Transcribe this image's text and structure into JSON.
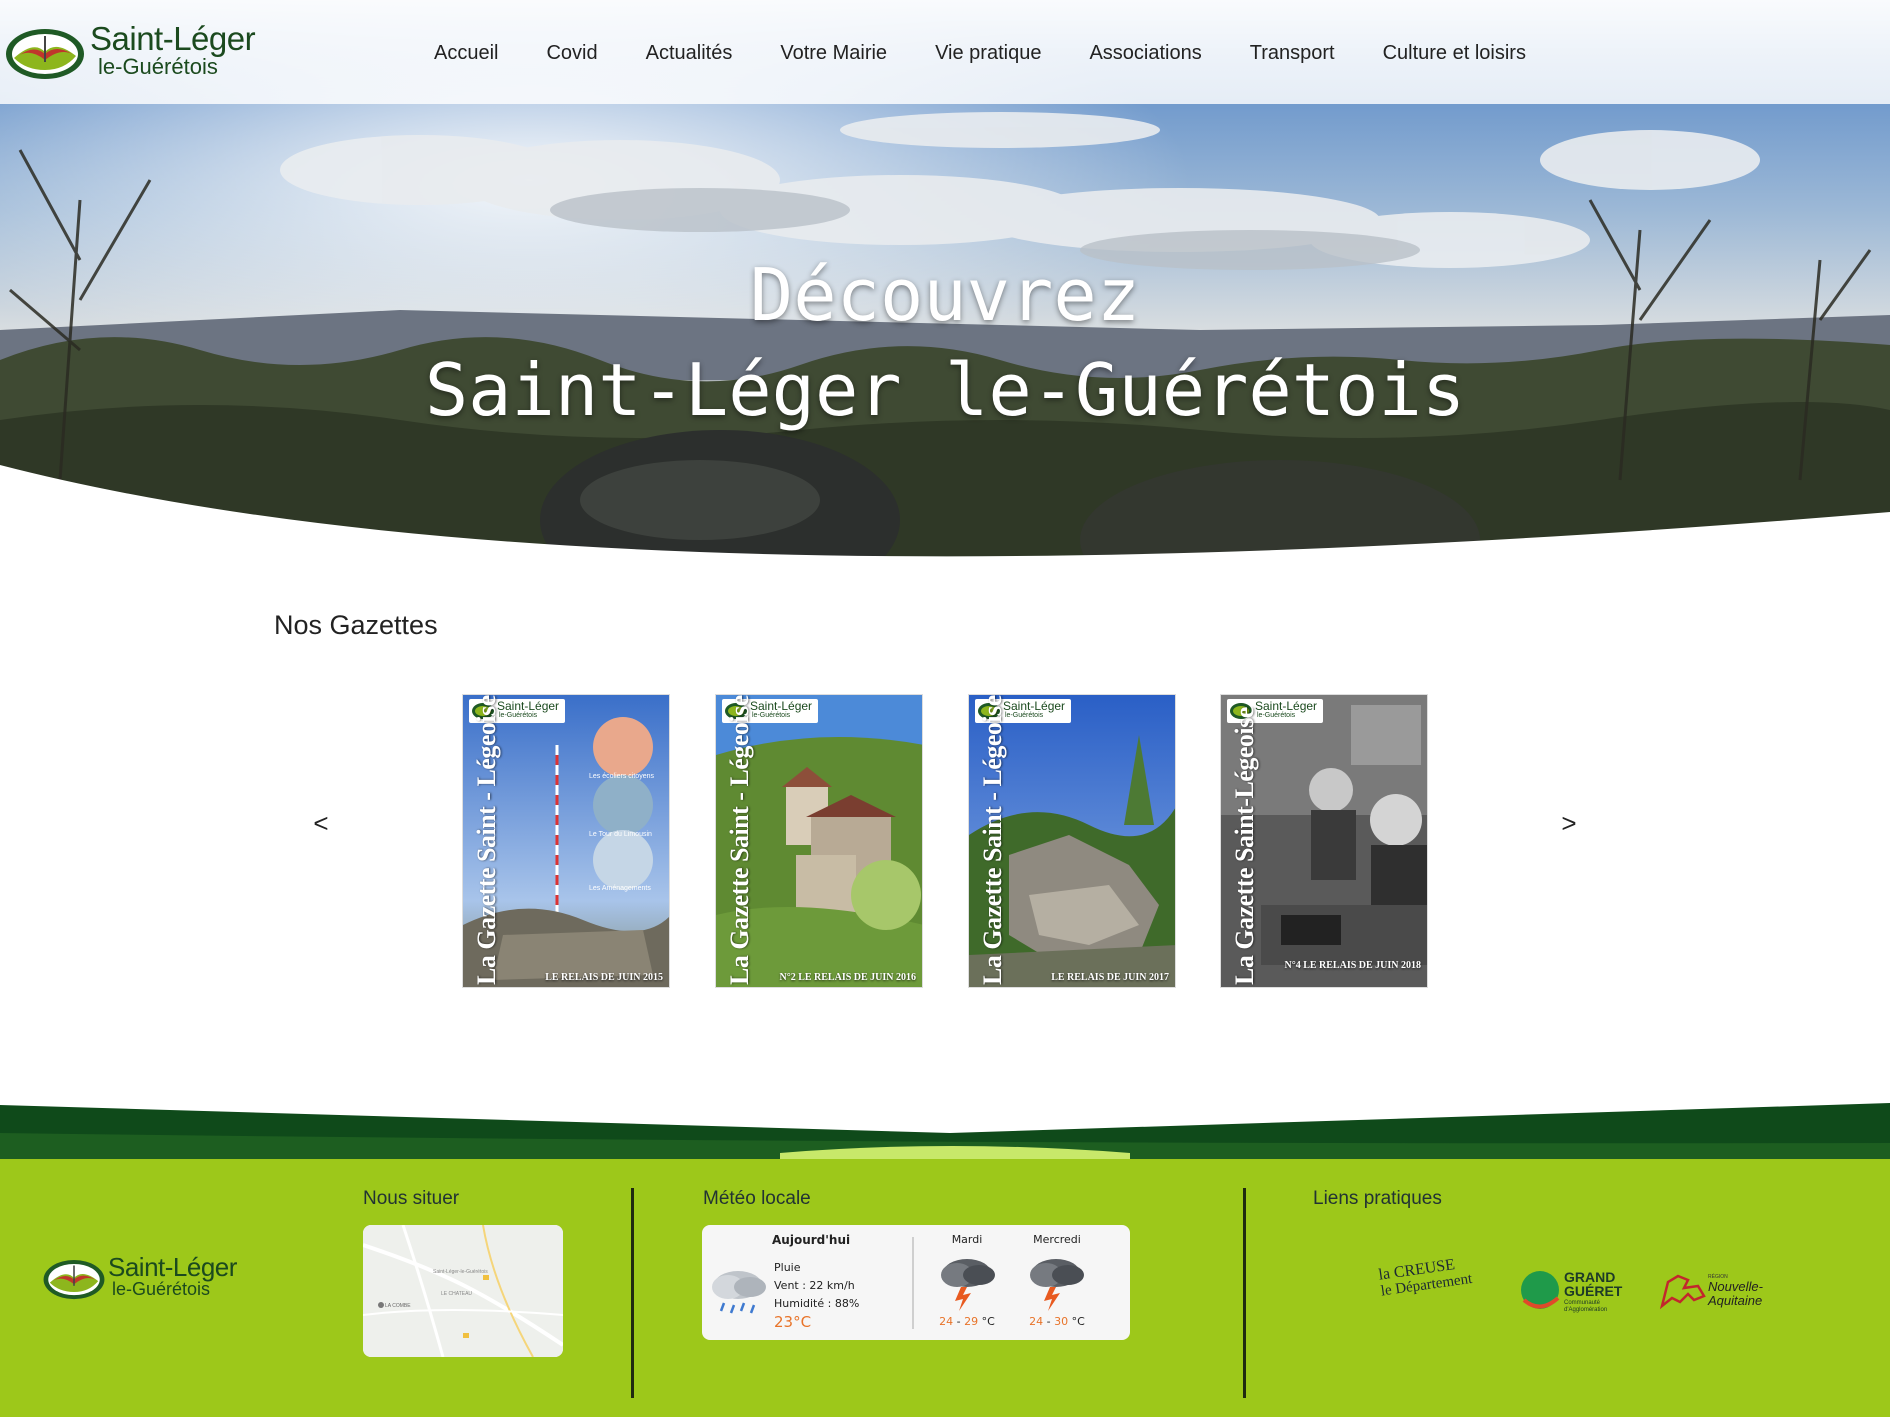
{
  "site": {
    "logo_line1": "Saint-Léger",
    "logo_line2": "le-Guérétois"
  },
  "nav": {
    "items": [
      "Accueil",
      "Covid",
      "Actualités",
      "Votre Mairie",
      "Vie pratique",
      "Associations",
      "Transport",
      "Culture et loisirs"
    ]
  },
  "hero": {
    "line1": "Découvrez",
    "line2": "Saint-Léger le-Guérétois"
  },
  "gazettes": {
    "title": "Nos Gazettes",
    "prev_label": "<",
    "next_label": ">",
    "items": [
      {
        "title": "La Gazette Saint - Légeoise",
        "footer": "LE RELAIS DE JUIN 2015",
        "captions": [
          "Les écoliers citoyens",
          "Le Tour du Limousin",
          "Les Aménagements"
        ]
      },
      {
        "title": "La Gazette Saint - Légeoise",
        "footer": "N°2  LE RELAIS DE JUIN 2016"
      },
      {
        "title": "La Gazette Saint - Légeoise",
        "footer": "LE RELAIS DE JUIN 2017"
      },
      {
        "title": "La Gazette Saint-Légeoise",
        "footer": "N°4 LE RELAIS DE JUIN 2018"
      }
    ],
    "badge_line1": "Saint-Léger",
    "badge_line2": "le-Guérétois"
  },
  "footer": {
    "locate_heading": "Nous situer",
    "weather_heading": "Météo locale",
    "links_heading": "Liens pratiques",
    "map_labels": [
      "Saint-Léger-le-Guérétois",
      "LA COMBE",
      "LE CHATEAU"
    ],
    "weather": {
      "today_label": "Aujourd'hui",
      "condition": "Pluie",
      "wind": "Vent : 22 km/h",
      "humidity": "Humidité : 88%",
      "temp": "23°C",
      "days": [
        {
          "name": "Mardi",
          "low": "24",
          "high": "29",
          "unit": "°C"
        },
        {
          "name": "Mercredi",
          "low": "24",
          "high": "30",
          "unit": "°C"
        }
      ]
    },
    "partners": {
      "creuse_line1": "la CREUSE",
      "creuse_line2": "le Département",
      "gueret_line1": "GRAND",
      "gueret_line2": "GUÉRET",
      "gueret_line3": "Communauté",
      "gueret_line4": "d'Agglomération",
      "region_small": "RÉGION",
      "region_line1": "Nouvelle-",
      "region_line2": "Aquitaine"
    }
  }
}
